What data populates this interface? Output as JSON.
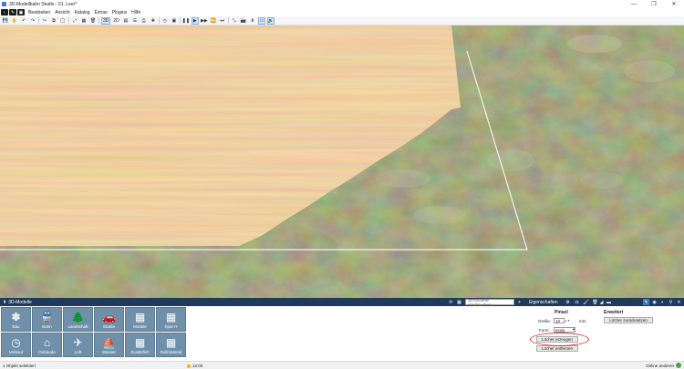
{
  "window": {
    "title": "3D-Modellbahn Studio - 01. Leer*",
    "minimize": "—",
    "maximize": "❐",
    "close": "✕"
  },
  "menu": {
    "back": "‹",
    "items": [
      "Bearbeiten",
      "Ansicht",
      "Katalog",
      "Extras",
      "Plugins",
      "Hilfe"
    ]
  },
  "toolbar": {
    "mode_3d": "3D",
    "mode_2d": "2D"
  },
  "panel": {
    "title": "3D-Modelle",
    "search_placeholder": "3D-Modelle durchsuchen...",
    "properties_title": "Eigenschaften"
  },
  "catalog": {
    "tiles": [
      {
        "label": "Bau",
        "icon": "✽"
      },
      {
        "label": "Bahn",
        "icon": "🚆"
      },
      {
        "label": "Landschaft",
        "icon": "🌲"
      },
      {
        "label": "Straße",
        "icon": "🚗"
      },
      {
        "label": "Module",
        "icon": "▦"
      },
      {
        "label": "Spur H",
        "icon": "▦"
      },
      {
        "label": "Verkauf",
        "icon": "◷"
      },
      {
        "label": "Gebäude",
        "icon": "⌂"
      },
      {
        "label": "Luft",
        "icon": "✈"
      },
      {
        "label": "Wasser",
        "icon": "⛵"
      },
      {
        "label": "Zusätzlich",
        "icon": "▦"
      },
      {
        "label": "Rollmaterial",
        "icon": "▦"
      }
    ]
  },
  "properties": {
    "pinsel_heading": "Pinsel",
    "erweitert_heading": "Erweitert",
    "groesse_label": "Größe:",
    "groesse_value": "10",
    "groesse_unit": "mm",
    "form_label": "Form:",
    "form_value": "Kreis",
    "btn_reset": "Löcher zurücksetzen",
    "btn_create": "Löcher erzeugen",
    "btn_remove": "Löcher entfernen"
  },
  "status": {
    "left": "1 Objekt selektiert",
    "time": "12:00",
    "right": "Online anderen"
  },
  "colors": {
    "panel_bar": "#1f3a5a",
    "tile": "#7090aa",
    "ground": "#6b6b45",
    "wood": "#e2b77c",
    "highlight_oval": "#dd3333"
  }
}
